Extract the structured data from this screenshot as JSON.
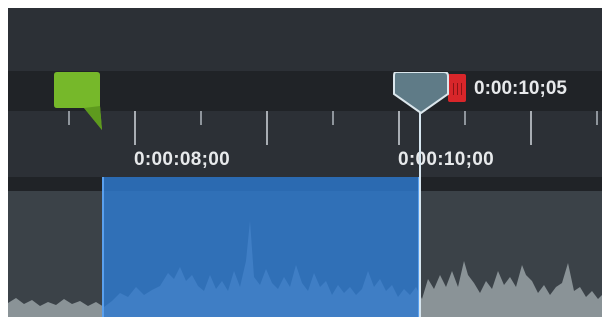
{
  "timeline": {
    "playhead_time": "0:00:10;05",
    "ruler_labels": [
      "0:00:08;00",
      "0:00:10;00"
    ]
  },
  "colors": {
    "selection": "#2e7acf",
    "marker_green": "#76b82a",
    "playhead": "#5f7b87",
    "marker_red": "#d8262a",
    "waveform": "#8a9397"
  },
  "icons": {
    "start_marker": "green-flag-marker-icon",
    "playhead": "playhead-icon",
    "end_marker": "red-marker-icon"
  }
}
